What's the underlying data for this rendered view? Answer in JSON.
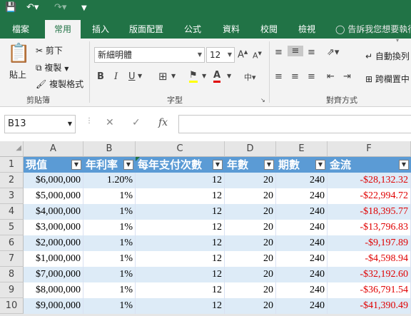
{
  "qat": {
    "save_icon": "save-icon",
    "undo_icon": "undo-icon",
    "redo_icon": "redo-icon",
    "customize_icon": "customize-icon"
  },
  "tabs": [
    "檔案",
    "常用",
    "插入",
    "版面配置",
    "公式",
    "資料",
    "校閱",
    "檢視"
  ],
  "tell_me": "告訴我您想要執行",
  "ribbon": {
    "clipboard": {
      "paste": "貼上",
      "cut": "剪下",
      "copy": "複製",
      "format_painter": "複製格式",
      "label": "剪貼簿"
    },
    "font": {
      "name": "新細明體",
      "size": "12",
      "bold": "B",
      "italic": "I",
      "underline": "U",
      "label": "字型"
    },
    "alignment": {
      "wrap": "自動換列",
      "merge": "跨欄置中",
      "label": "對齊方式"
    }
  },
  "formula_bar": {
    "name_box": "B13",
    "fx": "fx",
    "value": ""
  },
  "columns": [
    "A",
    "B",
    "C",
    "D",
    "E",
    "F"
  ],
  "headers": [
    "現值",
    "年利率",
    "每年支付次數",
    "年數",
    "期數",
    "金流"
  ],
  "rows": [
    {
      "n": "1",
      "a": "",
      "b": "",
      "c": "",
      "d": "",
      "e": "",
      "f": ""
    },
    {
      "n": "2",
      "a": "$6,000,000",
      "b": "1.20%",
      "c": "12",
      "d": "20",
      "e": "240",
      "f": "-$28,132.32"
    },
    {
      "n": "3",
      "a": "$5,000,000",
      "b": "1%",
      "c": "12",
      "d": "20",
      "e": "240",
      "f": "-$22,994.72"
    },
    {
      "n": "4",
      "a": "$4,000,000",
      "b": "1%",
      "c": "12",
      "d": "20",
      "e": "240",
      "f": "-$18,395.77"
    },
    {
      "n": "5",
      "a": "$3,000,000",
      "b": "1%",
      "c": "12",
      "d": "20",
      "e": "240",
      "f": "-$13,796.83"
    },
    {
      "n": "6",
      "a": "$2,000,000",
      "b": "1%",
      "c": "12",
      "d": "20",
      "e": "240",
      "f": "-$9,197.89"
    },
    {
      "n": "7",
      "a": "$1,000,000",
      "b": "1%",
      "c": "12",
      "d": "20",
      "e": "240",
      "f": "-$4,598.94"
    },
    {
      "n": "8",
      "a": "$7,000,000",
      "b": "1%",
      "c": "12",
      "d": "20",
      "e": "240",
      "f": "-$32,192.60"
    },
    {
      "n": "9",
      "a": "$8,000,000",
      "b": "1%",
      "c": "12",
      "d": "20",
      "e": "240",
      "f": "-$36,791.54"
    },
    {
      "n": "10",
      "a": "$9,000,000",
      "b": "1%",
      "c": "12",
      "d": "20",
      "e": "240",
      "f": "-$41,390.49"
    }
  ],
  "colors": {
    "brand": "#217346",
    "table_header": "#5b9bd5",
    "band": "#ddebf7",
    "negative": "#e00000"
  }
}
